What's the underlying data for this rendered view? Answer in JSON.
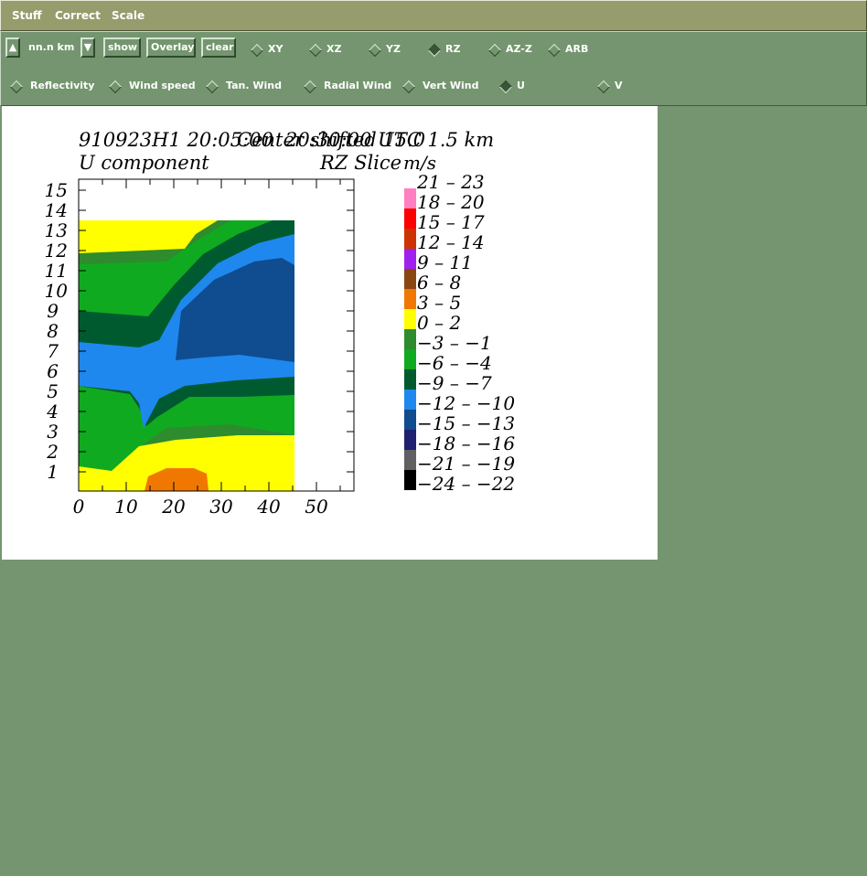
{
  "menu": {
    "items": [
      "Stuff",
      "Correct",
      "Scale"
    ]
  },
  "toolbar": {
    "up_arrow": "▲",
    "distance_label": "nn.n km",
    "down_arrow": "▼",
    "show": "show",
    "overlay": "Overlay",
    "clear": "clear",
    "views": [
      {
        "label": "XY",
        "selected": false
      },
      {
        "label": "XZ",
        "selected": false
      },
      {
        "label": "YZ",
        "selected": false
      },
      {
        "label": "RZ",
        "selected": true
      },
      {
        "label": "AZ-Z",
        "selected": false
      },
      {
        "label": "ARB",
        "selected": false
      }
    ],
    "fields": [
      {
        "label": "Reflectivity",
        "selected": false
      },
      {
        "label": "Wind speed",
        "selected": false
      },
      {
        "label": "Tan. Wind",
        "selected": false
      },
      {
        "label": "Radial Wind",
        "selected": false
      },
      {
        "label": "Vert Wind",
        "selected": false
      },
      {
        "label": "U",
        "selected": true
      },
      {
        "label": "V",
        "selected": false
      }
    ]
  },
  "plot": {
    "title_left": "910923H1  20:05:00",
    "title_overlap": "Center shifted 15.0",
    "title_right": "20:30:00 UTC  1.5 km",
    "subtitle_left": "U component",
    "subtitle_right": "RZ Slice",
    "units": "m/s",
    "y_ticks": [
      "15",
      "14",
      "13",
      "12",
      "11",
      "10",
      "9",
      "8",
      "7",
      "6",
      "5",
      "4",
      "3",
      "2",
      "1"
    ],
    "x_ticks": [
      "0",
      "10",
      "20",
      "30",
      "40",
      "50"
    ],
    "legend": [
      {
        "label": "21 – 23",
        "color": ""
      },
      {
        "label": "18 – 20",
        "color": "#ff7fc0"
      },
      {
        "label": "15 – 17",
        "color": "#ff0000"
      },
      {
        "label": "12 – 14",
        "color": "#cc3300"
      },
      {
        "label": "9 – 11",
        "color": "#a020f0"
      },
      {
        "label": "6 – 8",
        "color": "#8b4513"
      },
      {
        "label": "3 – 5",
        "color": "#f07800"
      },
      {
        "label": "0 – 2",
        "color": "#ffff00"
      },
      {
        "label": "−3 – −1",
        "color": "#2e8b2e"
      },
      {
        "label": "−6 – −4",
        "color": "#10aa20"
      },
      {
        "label": "−9 – −7",
        "color": "#005a30"
      },
      {
        "label": "−12 – −10",
        "color": "#1e88ee"
      },
      {
        "label": "−15 – −13",
        "color": "#104c90"
      },
      {
        "label": "−18 – −16",
        "color": "#202070"
      },
      {
        "label": "−21 – −19",
        "color": "#606060"
      },
      {
        "label": "−24 – −22",
        "color": "#000000"
      }
    ]
  }
}
